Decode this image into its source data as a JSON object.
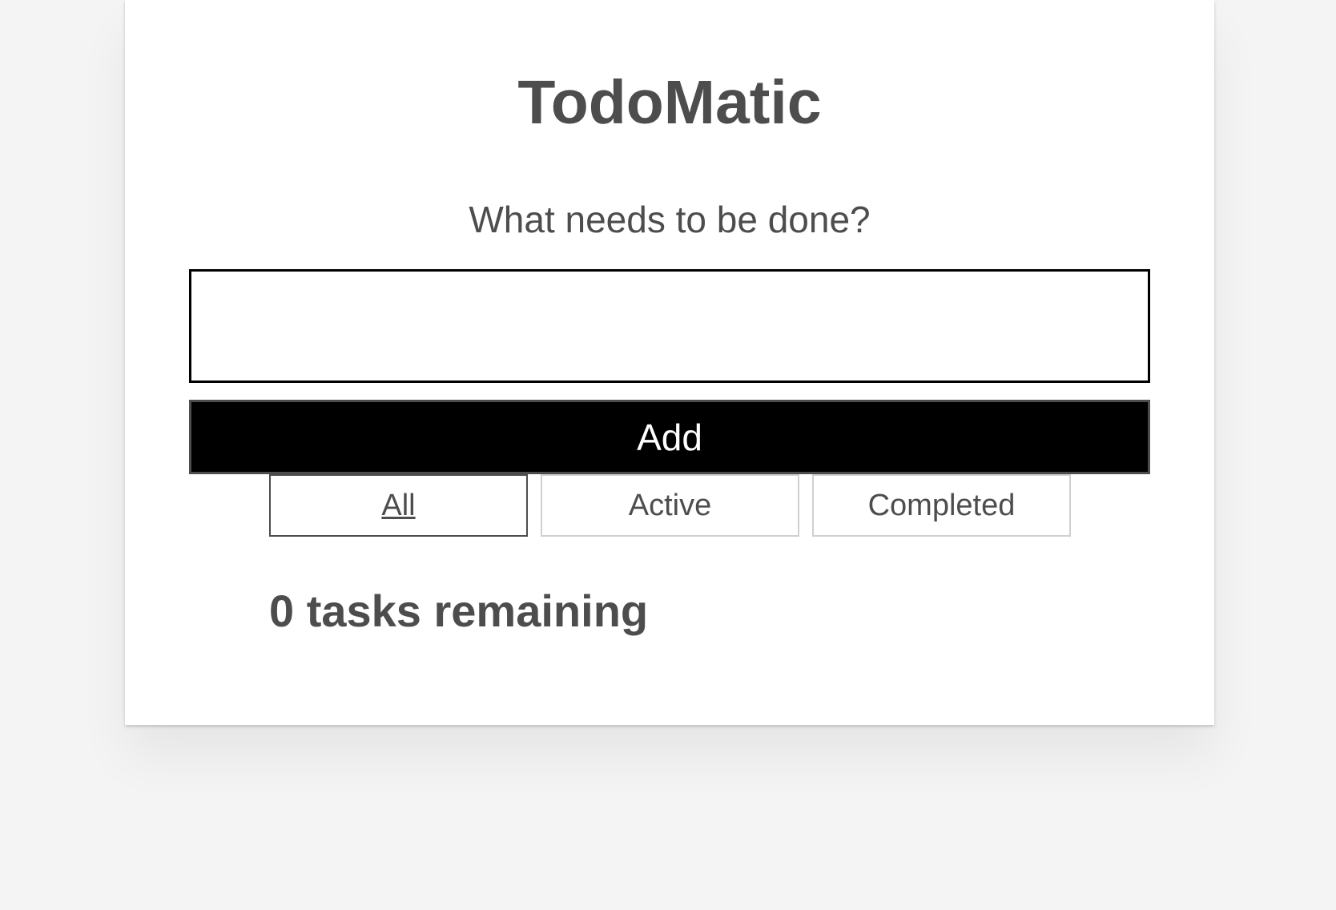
{
  "app": {
    "title": "TodoMatic",
    "prompt": "What needs to be done?",
    "input": {
      "value": "",
      "placeholder": ""
    },
    "add_label": "Add",
    "filters": [
      {
        "label": "All",
        "selected": true
      },
      {
        "label": "Active",
        "selected": false
      },
      {
        "label": "Completed",
        "selected": false
      }
    ],
    "remaining": "0 tasks remaining"
  },
  "colors": {
    "text": "#4d4d4d",
    "button_bg": "#000000",
    "button_text": "#ffffff",
    "page_bg": "#f4f4f4"
  }
}
